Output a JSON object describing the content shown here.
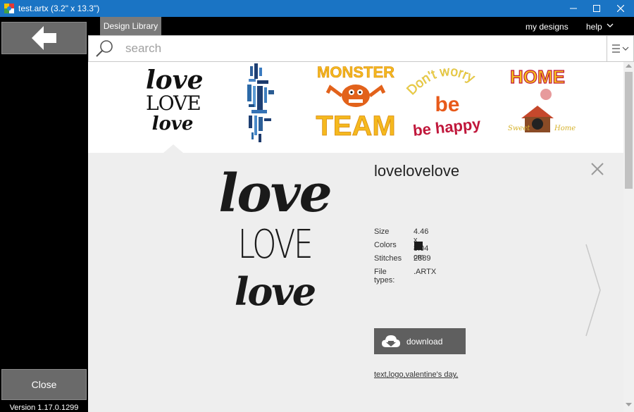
{
  "window": {
    "title": "test.artx (3.2\" x 13.3\")",
    "controls": [
      "minimize",
      "maximize",
      "close"
    ]
  },
  "left_panel": {
    "back_icon": "arrow-left-icon",
    "close_label": "Close",
    "version": "Version 1.17.0.1299"
  },
  "nav": {
    "tab_label": "Design Library",
    "my_designs": "my designs",
    "help": "help"
  },
  "search": {
    "placeholder": "search",
    "value": ""
  },
  "thumbnails": [
    {
      "name": "lovelovelove",
      "lines": [
        "love",
        "LOVE",
        "love"
      ],
      "selected": true
    },
    {
      "name": "word-cloud-design",
      "lines": []
    },
    {
      "name": "monster-team",
      "lines": [
        "MONSTER",
        "TEAM"
      ]
    },
    {
      "name": "dont-worry-be-happy",
      "lines": [
        "Don't worry",
        "be",
        "be happy"
      ]
    },
    {
      "name": "home-sweet-home",
      "lines": [
        "HOME",
        "Sweet",
        "Home"
      ]
    }
  ],
  "detail": {
    "title": "lovelovelove",
    "preview_lines": [
      "love",
      "LOVE",
      "love"
    ],
    "properties": {
      "size_label": "Size",
      "size_value": "4.46 x 8.04 cm",
      "colors_label": "Colors",
      "color_swatch": "#1a1a1a",
      "stitches_label": "Stitches",
      "stitches_value": "2889",
      "filetypes_label": "File types:",
      "filetypes_value": ".ARTX"
    },
    "download_label": "download",
    "tags": "text,logo,valentine's day,"
  },
  "colors": {
    "titlebar": "#1a74c4",
    "sidebar": "#000000",
    "button": "#6a6a6a",
    "detail_bg": "#eeeeee",
    "download": "#5f5f5f"
  }
}
